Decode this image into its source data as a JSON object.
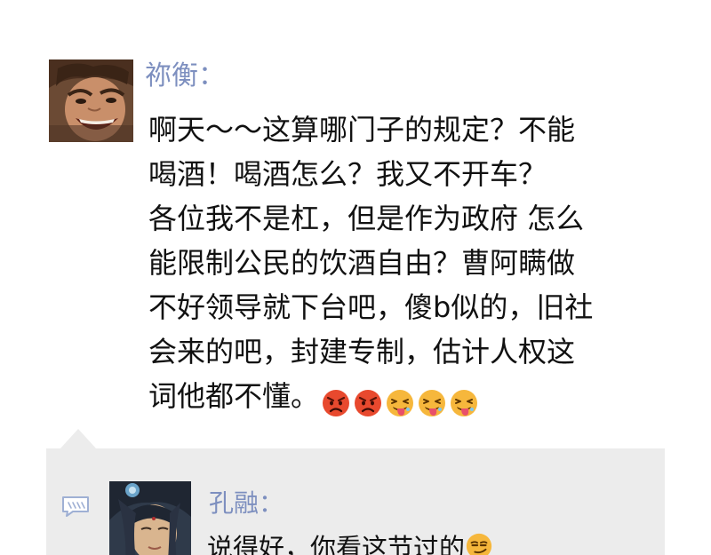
{
  "post": {
    "author_name": "祢衡：",
    "lines": [
      "啊天～～这算哪门子的规定？不能",
      "喝酒！喝酒怎么？我又不开车？",
      "各位我不是杠，但是作为政府 怎么",
      "能限制公民的饮酒自由？曹阿瞒做",
      "不好领导就下台吧，傻b似的，旧社",
      "会来的吧，封建专制，估计人权这",
      "词他都不懂。"
    ],
    "emojis": [
      "angry-face",
      "angry-face",
      "grimacing-tongue-face",
      "grimacing-tongue-face",
      "grimacing-tongue-face"
    ]
  },
  "comment": {
    "author_name": "孔融：",
    "text": "说得好，你看这节过的",
    "emoji": "smirk-face"
  },
  "colors": {
    "author_name": "#7d8fbf",
    "body_text": "#111111",
    "panel_bg": "#ececec"
  }
}
